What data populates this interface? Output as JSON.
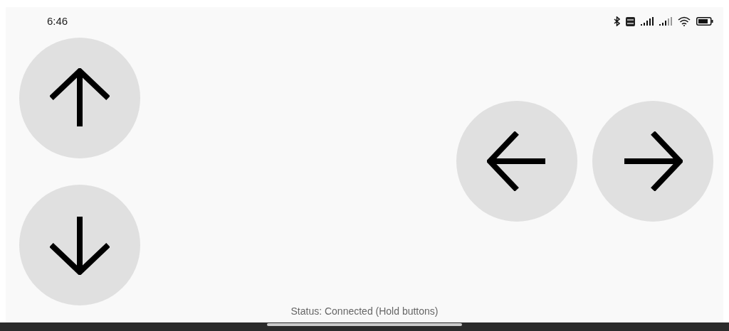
{
  "status_bar": {
    "time": "6:46"
  },
  "buttons": [
    {
      "kind": "up"
    },
    {
      "kind": "down"
    },
    {
      "kind": "left"
    },
    {
      "kind": "right"
    }
  ],
  "status_text": "Status: Connected (Hold buttons)"
}
